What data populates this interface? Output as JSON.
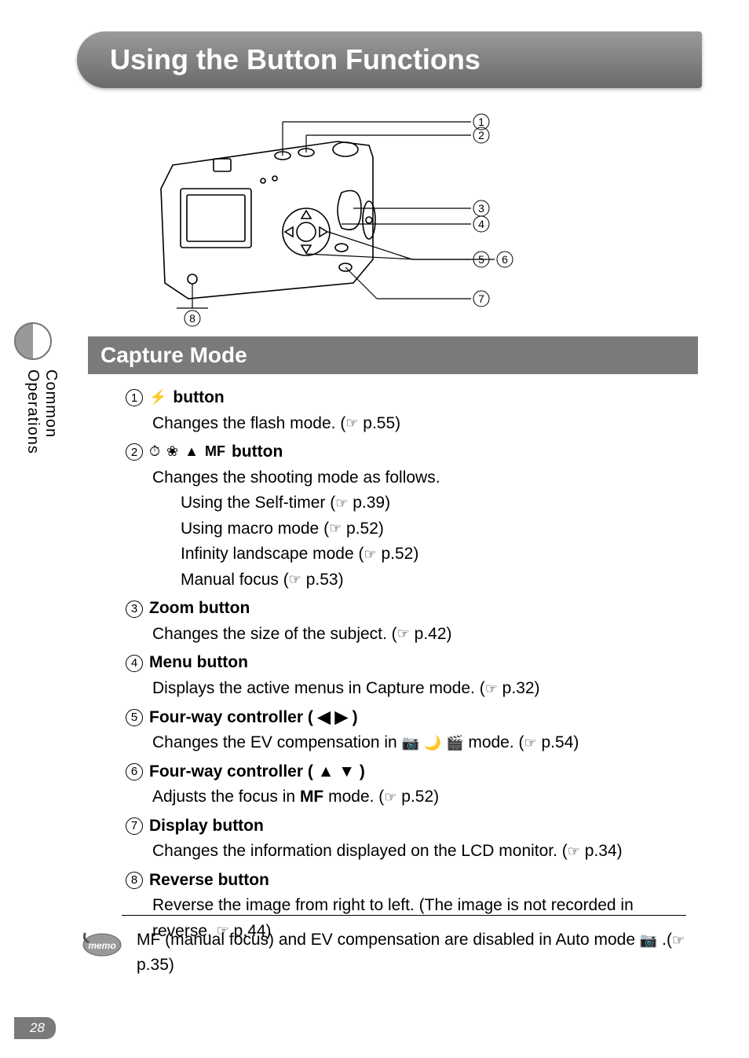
{
  "pageNumber": "28",
  "sideTabLabel": "Common Operations",
  "title": "Using the Button Functions",
  "sectionTitle": "Capture Mode",
  "diagram": {
    "callouts": [
      "1",
      "2",
      "3",
      "4",
      "5",
      "6",
      "7",
      "8"
    ]
  },
  "items": [
    {
      "num": "1",
      "headingIcons": [
        "flash"
      ],
      "headingText": "button",
      "lines": [
        {
          "text": "Changes the flash mode. (",
          "ref": true,
          "after": " p.55)"
        }
      ]
    },
    {
      "num": "2",
      "headingIcons": [
        "timer",
        "macro",
        "mountain",
        "MF"
      ],
      "headingText": "button",
      "lines": [
        {
          "text": "Changes the shooting mode as follows."
        }
      ],
      "subLines": [
        {
          "text": "Using the Self-timer (",
          "ref": true,
          "after": " p.39)"
        },
        {
          "text": "Using macro mode (",
          "ref": true,
          "after": " p.52)"
        },
        {
          "text": "Infinity landscape mode (",
          "ref": true,
          "after": " p.52)"
        },
        {
          "text": "Manual focus (",
          "ref": true,
          "after": " p.53)"
        }
      ]
    },
    {
      "num": "3",
      "headingText": "Zoom button",
      "lines": [
        {
          "text": "Changes the size of the subject. (",
          "ref": true,
          "after": " p.42)"
        }
      ]
    },
    {
      "num": "4",
      "headingText": "Menu button",
      "lines": [
        {
          "text": "Displays the active menus in Capture mode. (",
          "ref": true,
          "after": " p.32)"
        }
      ]
    },
    {
      "num": "5",
      "headingText": "Four-way controller ( ◀ ▶ )",
      "lines": [
        {
          "text": "Changes the EV compensation in ",
          "modeIcons": true,
          "mid": " mode. (",
          "ref": true,
          "after": " p.54)"
        }
      ]
    },
    {
      "num": "6",
      "headingText": "Four-way controller ( ▲ ▼ )",
      "lines": [
        {
          "text": "Adjusts the focus in ",
          "mfIcon": true,
          "mid": " mode. (",
          "ref": true,
          "after": " p.52)"
        }
      ]
    },
    {
      "num": "7",
      "headingText": "Display button",
      "lines": [
        {
          "text": "Changes the information displayed on the LCD monitor. (",
          "ref": true,
          "after": " p.34)"
        }
      ]
    },
    {
      "num": "8",
      "headingText": "Reverse button",
      "lines": [
        {
          "text": "Reverse the image from right to left. (The image is not recorded in reverse. ",
          "ref": true,
          "after": " p.44)"
        }
      ]
    }
  ],
  "memo": {
    "label": "memo",
    "textBefore": "MF (manual focus) and EV compensation are disabled in Auto mode ",
    "textAfter": " .(",
    "pageRef": " p.35)"
  }
}
